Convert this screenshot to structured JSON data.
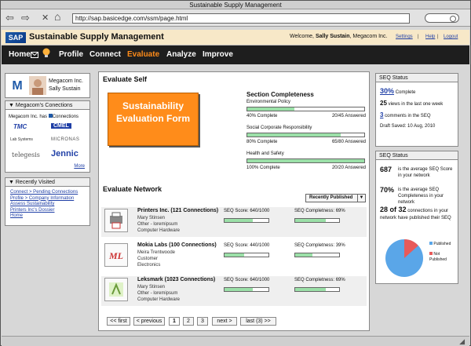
{
  "window": {
    "title": "Sustainable Supply Management"
  },
  "browser": {
    "back": "⇦",
    "forward": "⇨",
    "close": "✕",
    "home": "⌂",
    "url": "http://sap.basicedge.com/ssm/page.html"
  },
  "header": {
    "app_title": "Sustainable Supply Management",
    "welcome_prefix": "Welcome,",
    "user_name": "Sally Sustain",
    "company_suffix": ", Megacom Inc.",
    "links": [
      "Settings",
      "Help",
      "Logout"
    ],
    "separator": "|"
  },
  "menu": {
    "home": "Home",
    "items": [
      "Profile",
      "Connect",
      "Evaluate",
      "Analyze",
      "Improve"
    ],
    "active": "Evaluate"
  },
  "profile": {
    "company": "Megacom Inc.",
    "user": "Sally Sustain"
  },
  "connections_box": {
    "title": "Megacom's Conections",
    "has_text": "Megacom Inc. has",
    "has_link": "Connections",
    "logos": [
      "TMC",
      "CMEL",
      "Lab Systems",
      "MICRONAS",
      "telegesis",
      "Jennic"
    ],
    "more": "More"
  },
  "recent_box": {
    "title": "Recently Visited",
    "links": [
      "Connect > Pending Connections",
      "Profile > Company Information",
      "Assess Sustainability",
      "Printers Inc's Dossier",
      "Home"
    ]
  },
  "evaluate_self": {
    "title": "Evaluate Self",
    "form_label": "Sustainability Evaluation Form",
    "completeness_title": "Section Completeness",
    "sections": [
      {
        "name": "Environmental Policy",
        "percent": 40,
        "complete_label": "40% Complete",
        "answered": "20/45 Answered"
      },
      {
        "name": "Social Corporate Responsibility",
        "percent": 80,
        "complete_label": "80% Complete",
        "answered": "65/80 Answered"
      },
      {
        "name": "Health and Safety",
        "percent": 100,
        "complete_label": "100% Complete",
        "answered": "20/20 Answered"
      }
    ]
  },
  "evaluate_network": {
    "title": "Evaluate Network",
    "sort_label": "Recently Published",
    "companies": [
      {
        "name": "Printers Inc. (121 Connections)",
        "person": "Mary Stinsen",
        "detail": "Other - loremipsum",
        "category": "Computer Hardware",
        "score_label": "SEQ Score: 640/1000",
        "score": 64,
        "completeness_label": "SEQ Completness: 69%",
        "completeness": 69,
        "logo": "printer-logo"
      },
      {
        "name": "Mokia Labs (100 Connections)",
        "person": "Meira Trentwoode",
        "detail": "Customer",
        "category": "Electronics",
        "score_label": "SEQ Score: 440/1000",
        "score": 44,
        "completeness_label": "SEQ Completness: 39%",
        "completeness": 39,
        "logo": "ML"
      },
      {
        "name": "Leksmark (1023 Connections)",
        "person": "Mary Stinsen",
        "detail": "Other - loremipsum",
        "category": "Computer Hardware",
        "score_label": "SEQ Score: 640/1000",
        "score": 64,
        "completeness_label": "SEQ Completness: 69%",
        "completeness": 69,
        "logo": "leksmark-logo"
      }
    ],
    "pager": [
      "<< first",
      "< previous",
      "1",
      "2",
      "3",
      "next >",
      "last (3) >>"
    ]
  },
  "seq_status_1": {
    "title": "SEQ Status",
    "complete_value": "30%",
    "complete_label": "Complete",
    "views_value": "25",
    "views_label": "views in the last one week",
    "comments_value": "3",
    "comments_label": "comments in the SEQ",
    "draft_saved": "Draft Saved: 10 Aug, 2010"
  },
  "seq_status_2": {
    "title": "SEQ Status",
    "avg_score_value": "687",
    "avg_score_label": "is the average SEQ Score in your network",
    "avg_complete_value": "70%",
    "avg_complete_label": "is the average SEQ Completeness in your network",
    "published_value": "28 of 32",
    "published_label": "connections in your network have published their SEQ",
    "legend_published": "Published",
    "legend_not_published": "Not Published",
    "colors": {
      "published": "#5aa6e8",
      "not_published": "#e85a5a"
    }
  },
  "colors": {
    "accent_orange": "#ff8c1a",
    "progress_green": "#9be0a8",
    "link_blue": "#1f3fa6"
  }
}
